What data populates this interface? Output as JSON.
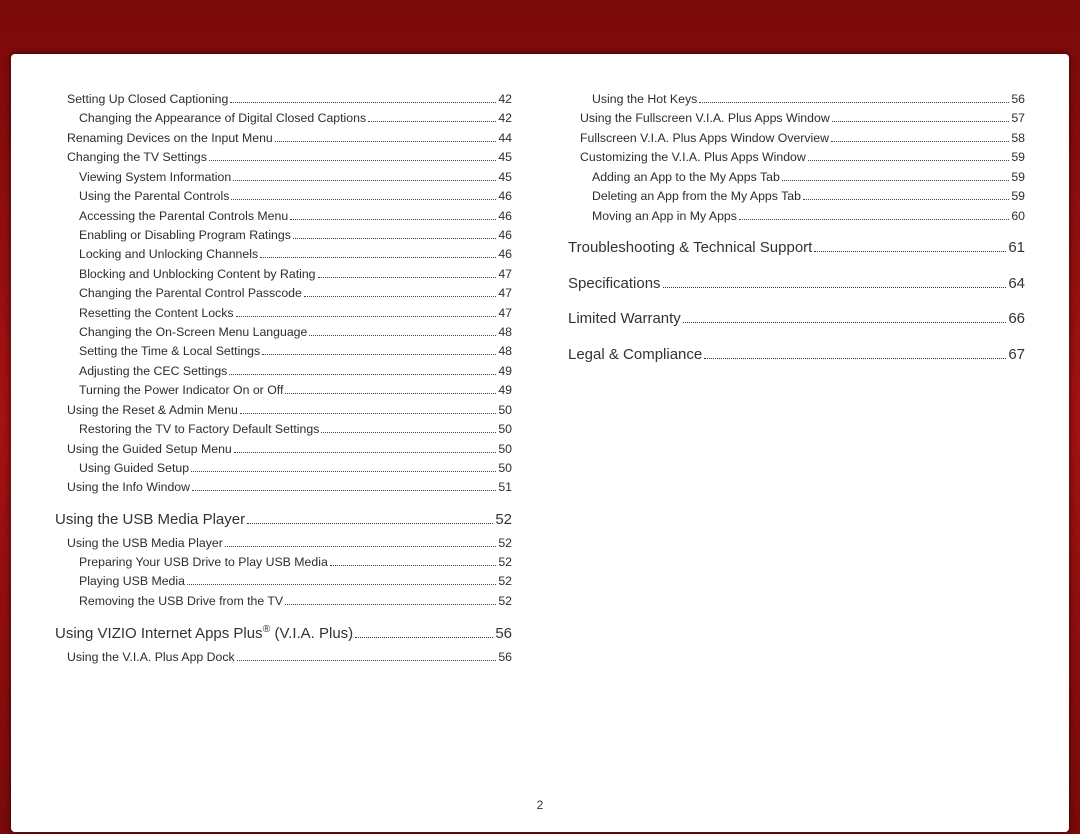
{
  "page_number": "2",
  "columns": [
    {
      "items": [
        {
          "level": 1,
          "label": "Setting Up Closed Captioning",
          "page": "42"
        },
        {
          "level": 2,
          "label": "Changing the Appearance of Digital Closed Captions",
          "page": "42",
          "tight": true
        },
        {
          "level": 1,
          "label": "Renaming Devices on the Input Menu",
          "page": "44"
        },
        {
          "level": 1,
          "label": "Changing the TV Settings",
          "page": "45"
        },
        {
          "level": 2,
          "label": "Viewing System Information",
          "page": "45"
        },
        {
          "level": 2,
          "label": "Using the Parental Controls",
          "page": "46"
        },
        {
          "level": 2,
          "label": "Accessing the Parental Controls Menu",
          "page": "46"
        },
        {
          "level": 2,
          "label": "Enabling or Disabling Program Ratings",
          "page": "46"
        },
        {
          "level": 2,
          "label": "Locking and Unlocking Channels",
          "page": "46"
        },
        {
          "level": 2,
          "label": "Blocking and Unblocking Content by Rating",
          "page": "47"
        },
        {
          "level": 2,
          "label": "Changing the Parental Control Passcode",
          "page": "47"
        },
        {
          "level": 2,
          "label": "Resetting the Content Locks",
          "page": "47"
        },
        {
          "level": 2,
          "label": "Changing the On-Screen Menu Language",
          "page": "48"
        },
        {
          "level": 2,
          "label": "Setting the Time & Local Settings",
          "page": "48"
        },
        {
          "level": 2,
          "label": "Adjusting the CEC Settings",
          "page": "49"
        },
        {
          "level": 2,
          "label": "Turning the Power Indicator On or Off",
          "page": "49"
        },
        {
          "level": 1,
          "label": "Using the Reset & Admin Menu",
          "page": "50"
        },
        {
          "level": 2,
          "label": "Restoring the TV to Factory Default Settings",
          "page": "50"
        },
        {
          "level": 1,
          "label": "Using the Guided Setup Menu",
          "page": "50"
        },
        {
          "level": 2,
          "label": "Using Guided Setup",
          "page": "50"
        },
        {
          "level": 1,
          "label": "Using the Info Window",
          "page": "51"
        },
        {
          "level": 0,
          "label": "Using the USB Media Player",
          "page": "52"
        },
        {
          "level": 1,
          "label": "Using the USB Media Player",
          "page": "52"
        },
        {
          "level": 2,
          "label": "Preparing Your USB Drive to Play USB Media",
          "page": "52"
        },
        {
          "level": 2,
          "label": "Playing USB Media",
          "page": "52"
        },
        {
          "level": 2,
          "label": "Removing the USB Drive from the TV",
          "page": "52"
        },
        {
          "level": 0,
          "label": "Using VIZIO Internet Apps Plus® (V.I.A. Plus)",
          "page": "56"
        },
        {
          "level": 1,
          "label": "Using the V.I.A. Plus App Dock",
          "page": "56"
        }
      ]
    },
    {
      "items": [
        {
          "level": 2,
          "label": "Using the Hot Keys",
          "page": "56"
        },
        {
          "level": 1,
          "label": "Using the Fullscreen V.I.A. Plus Apps Window",
          "page": "57"
        },
        {
          "level": 1,
          "label": "Fullscreen V.I.A. Plus Apps Window Overview",
          "page": "58"
        },
        {
          "level": 1,
          "label": "Customizing the V.I.A. Plus Apps Window",
          "page": "59"
        },
        {
          "level": 2,
          "label": "Adding an App to the My Apps Tab",
          "page": "59"
        },
        {
          "level": 2,
          "label": "Deleting an App from the My Apps Tab",
          "page": "59"
        },
        {
          "level": 2,
          "label": "Moving an App in My Apps",
          "page": "60"
        },
        {
          "level": 0,
          "label": "Troubleshooting & Technical Support",
          "page": "61"
        },
        {
          "level": 0,
          "label": "Specifications",
          "page": "64"
        },
        {
          "level": 0,
          "label": "Limited Warranty",
          "page": "66"
        },
        {
          "level": 0,
          "label": "Legal & Compliance",
          "page": "67"
        }
      ]
    }
  ]
}
